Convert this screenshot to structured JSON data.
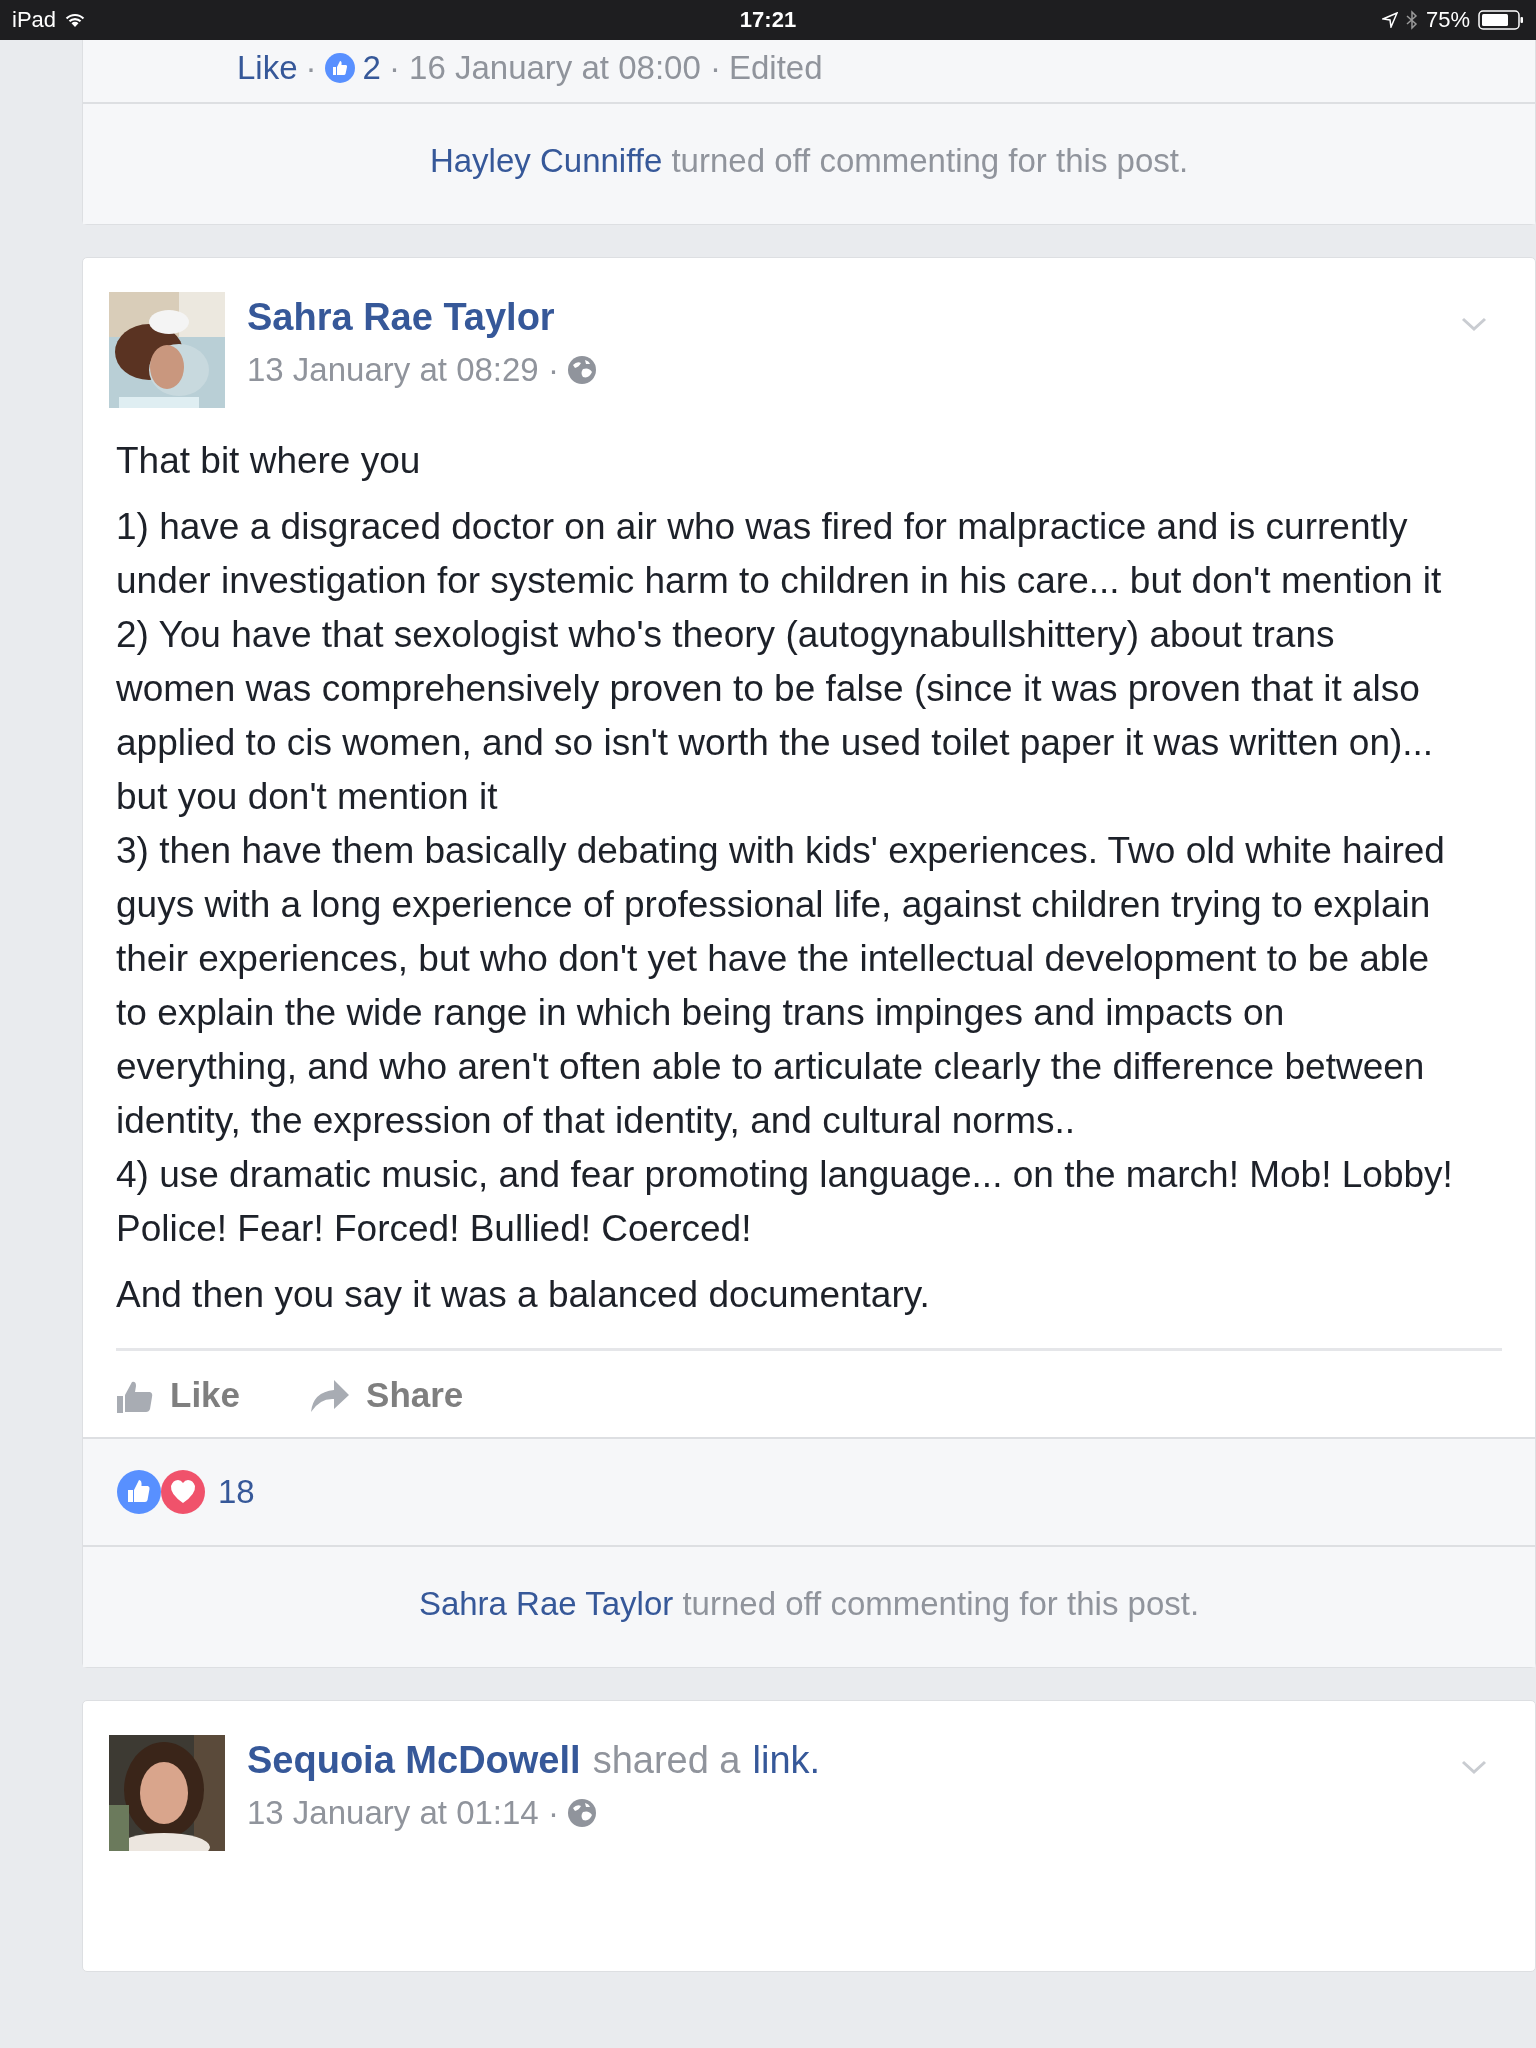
{
  "status_bar": {
    "device": "iPad",
    "time": "17:21",
    "battery": "75%"
  },
  "posts": [
    {
      "kind": "tail",
      "comment_meta": {
        "like": "Like",
        "separator": "·",
        "likes": "2",
        "time": "· 16 January at 08:00 ·",
        "edited": "Edited"
      },
      "comments_off": {
        "name": "Hayley Cunniffe",
        "text": "turned off commenting for this post."
      }
    },
    {
      "kind": "full",
      "author": "Sahra Rae Taylor",
      "time": "13 January at 08:29 ·",
      "paragraphs": [
        {
          "lines": [
            "That bit where you"
          ]
        },
        {
          "lines": [
            "1) have a disgraced doctor on air who was fired for malpractice and is currently under investigation for systemic harm to children in his care... but don't mention it",
            "2) You have that sexologist who's theory (autogynabullshittery) about trans women was comprehensively proven to be false (since it was proven that it also applied to cis women, and so isn't worth the used toilet paper it was written on)... but you don't mention it",
            "3) then have them basically debating with kids' experiences. Two old white haired guys with a long experience of professional life, against children trying to explain their experiences, but who don't yet have the intellectual development to be able to explain the wide range in which being trans impinges and impacts on everything, and who aren't often able to articulate clearly the difference between identity, the expression of that identity, and cultural norms..",
            "4) use dramatic music, and fear promoting language... on the march! Mob! Lobby! Police! Fear! Forced! Bullied! Coerced!"
          ]
        },
        {
          "lines": [
            "And then you say it was a balanced documentary."
          ]
        }
      ],
      "actions": [
        {
          "kind": "like",
          "label": "Like"
        },
        {
          "kind": "share",
          "label": "Share"
        }
      ],
      "reactions_count": "18",
      "comments_off": {
        "name": "Sahra Rae Taylor",
        "text": "turned off commenting for this post."
      }
    },
    {
      "kind": "header",
      "author": "Sequoia McDowell",
      "action": "shared a",
      "link": "link.",
      "time": "13 January at 01:14 ·"
    }
  ]
}
